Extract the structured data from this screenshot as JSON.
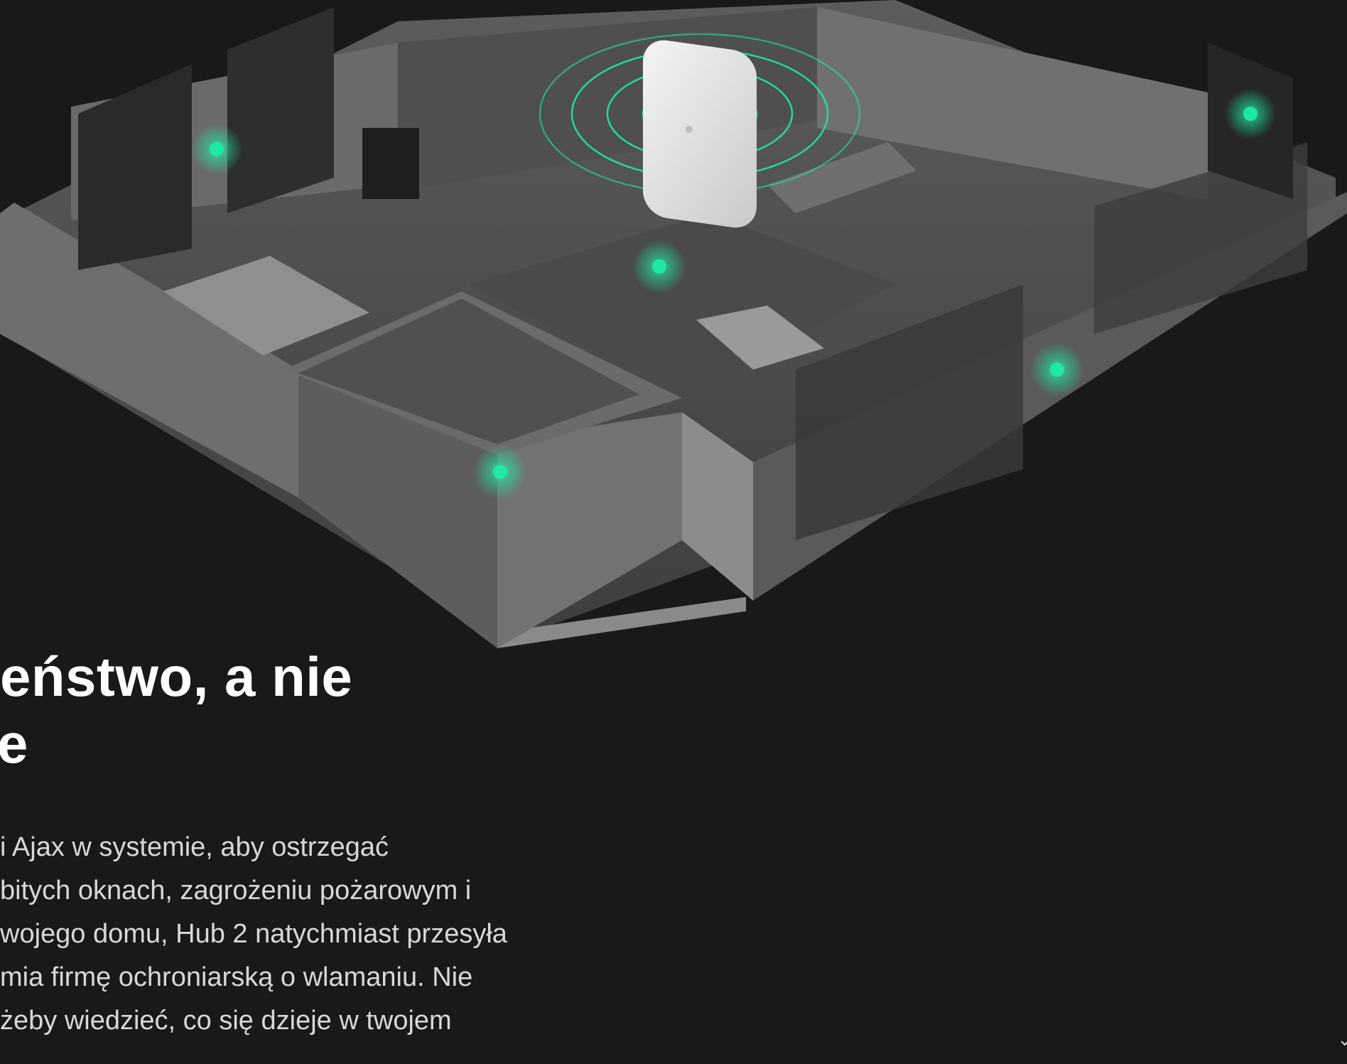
{
  "hero": {
    "headline_line1": "eństwo, a nie",
    "headline_line2": "e",
    "body_lines": [
      "i Ajax w systemie, aby ostrzegać",
      "bitych oknach, zagrożeniu pożarowym i",
      "wojego domu, Hub 2 natychmiast przesyła",
      "mia firmę ochroniarską o wlamaniu. Nie",
      " żeby wiedzieć, co się dzieje w twojem"
    ]
  },
  "colors": {
    "background": "#191919",
    "accent_signal": "#1de9a6",
    "headline": "#ffffff",
    "body": "#d8d8d8"
  },
  "icons": {
    "hub": "hub-device-icon",
    "sensor": "sensor-signal-icon",
    "scroll": "chevron-down-icon"
  },
  "scroll_glyph": "⌄"
}
